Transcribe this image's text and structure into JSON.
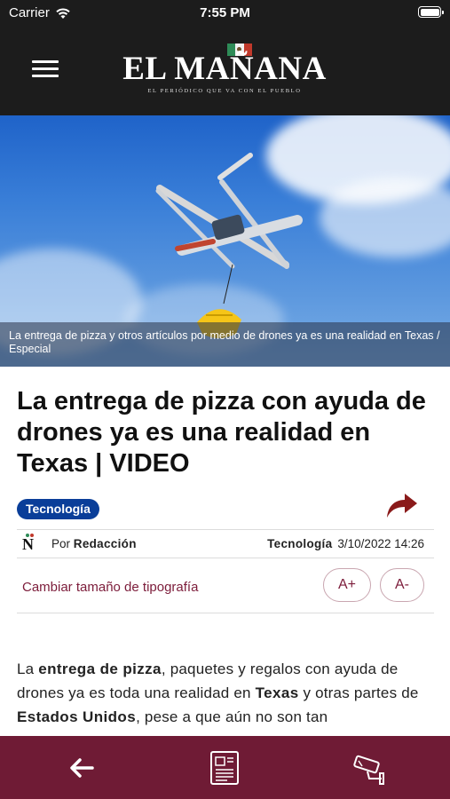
{
  "status_bar": {
    "carrier": "Carrier",
    "time": "7:55 PM"
  },
  "header": {
    "logo": "EL MAÑANA",
    "tagline": "EL PERIÓDICO QUE VA CON EL PUEBLO"
  },
  "hero": {
    "caption": "La entrega de pizza y otros artículos por medio de drones ya es una realidad en Texas / Especial"
  },
  "article": {
    "headline": "La entrega de pizza con ayuda de drones ya es una realidad en Texas | VIDEO",
    "category": "Tecnología",
    "byline_prefix": "Por",
    "author": "Redacción",
    "section": "Tecnología",
    "datetime": "3/10/2022 14:26",
    "font_size_label": "Cambiar tamaño de tipografía",
    "font_increase": "A+",
    "font_decrease": "A-",
    "body": {
      "t1": "La ",
      "b1": "entrega de pizza",
      "t2": ", paquetes y regalos con ayuda de drones ya es toda una realidad en ",
      "b2": "Texas",
      "t3": " y otras partes de ",
      "b3": "Estados Unidos",
      "t4": ", pese a que aún no son tan"
    }
  },
  "icons": {
    "status": [
      "wifi-icon",
      "battery-icon"
    ],
    "header": [
      "hamburger-menu-icon",
      "mexico-flag-icon"
    ],
    "article": [
      "share-arrow-icon",
      "el-manana-n-logo"
    ],
    "bottom_bar": [
      "back-arrow-icon",
      "newspaper-icon",
      "security-camera-icon"
    ]
  },
  "colors": {
    "header_bg": "#1c1c1c",
    "badge_bg": "#0a3e99",
    "accent": "#7c1c3a",
    "bottom_bar_bg": "#6f1b35"
  }
}
